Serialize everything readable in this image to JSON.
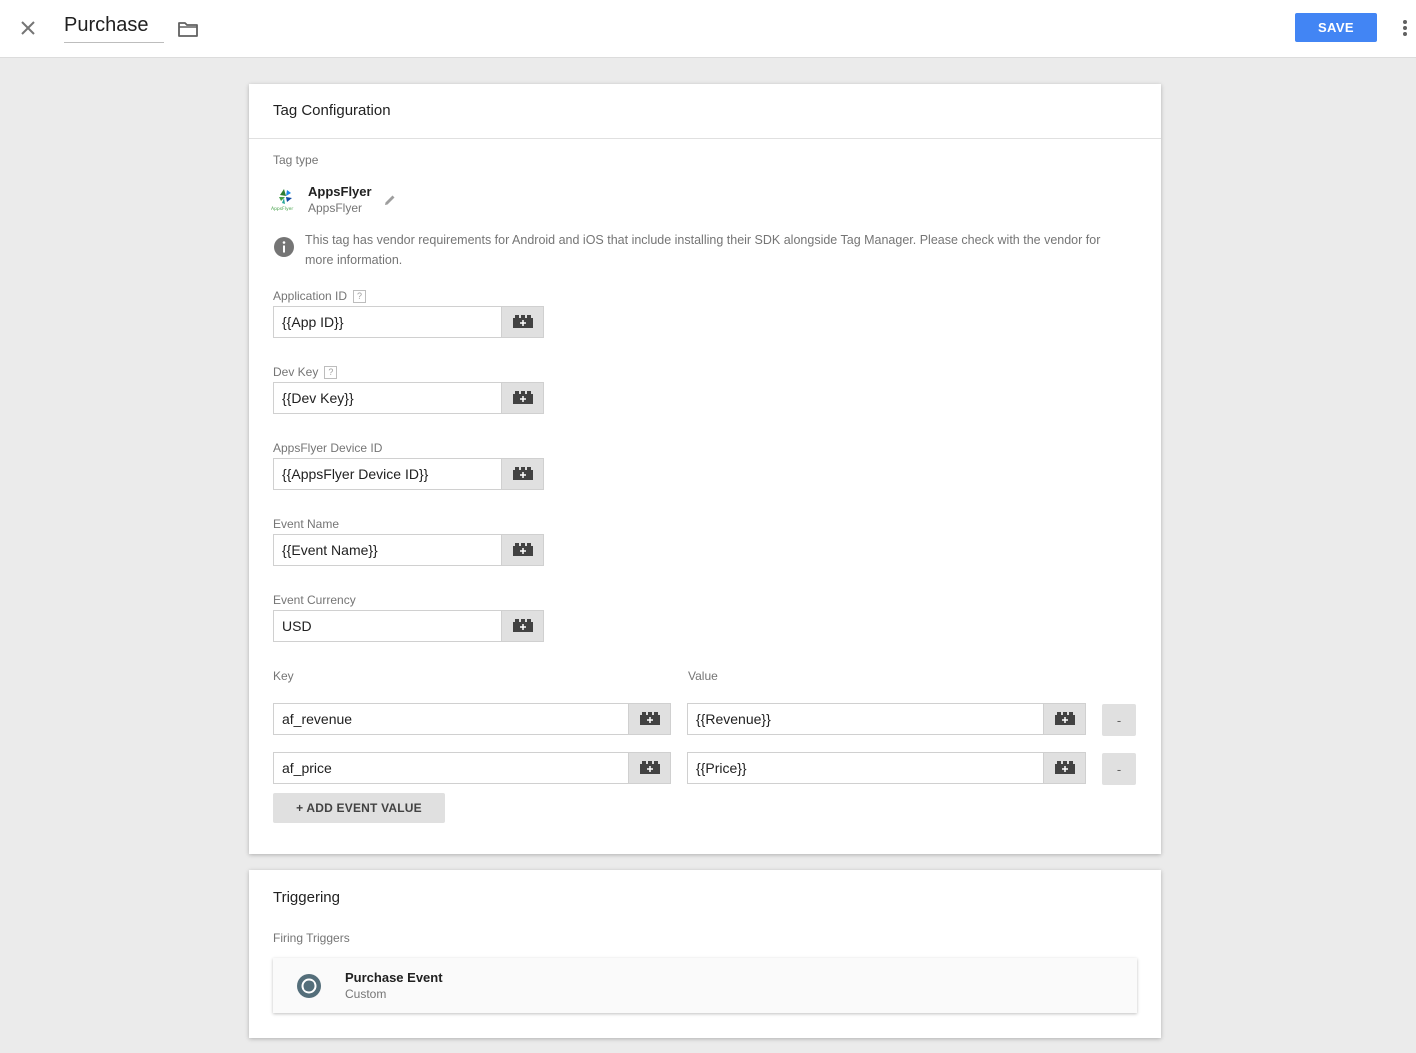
{
  "header": {
    "title": "Purchase",
    "save_label": "SAVE"
  },
  "tag_config": {
    "heading": "Tag Configuration",
    "tag_type_label": "Tag type",
    "tag_type_name": "AppsFlyer",
    "tag_type_vendor": "AppsFlyer",
    "logo_text": "AppsFlyer",
    "vendor_notice_line1": "This tag has vendor requirements for Android and iOS that include installing their SDK alongside Tag Manager. Please check with the vendor for",
    "vendor_notice_line2": "more information.",
    "help_glyph": "?",
    "fields": {
      "app_id": {
        "label": "Application ID",
        "value": "{{App ID}}"
      },
      "dev_key": {
        "label": "Dev Key",
        "value": "{{Dev Key}}"
      },
      "device_id": {
        "label": "AppsFlyer Device ID",
        "value": "{{AppsFlyer Device ID}}"
      },
      "event_name": {
        "label": "Event Name",
        "value": "{{Event Name}}"
      },
      "event_currency": {
        "label": "Event Currency",
        "value": "USD"
      }
    },
    "event_values": {
      "key_header": "Key",
      "value_header": "Value",
      "remove_label": "-",
      "rows": [
        {
          "key": "af_revenue",
          "value": "{{Revenue}}"
        },
        {
          "key": "af_price",
          "value": "{{Price}}"
        }
      ],
      "add_label": "+ ADD EVENT VALUE"
    }
  },
  "triggering": {
    "heading": "Triggering",
    "firing_label": "Firing Triggers",
    "trigger": {
      "name": "Purchase Event",
      "type": "Custom"
    }
  },
  "icons": {
    "close": "close-icon",
    "folder": "folder-icon",
    "more": "more-vert-icon",
    "edit": "pencil-icon",
    "info": "info-icon",
    "variable": "variable-brick-icon",
    "trigger": "custom-event-trigger-icon"
  },
  "colors": {
    "primary_button": "#4285f4",
    "background": "#ebebeb"
  }
}
